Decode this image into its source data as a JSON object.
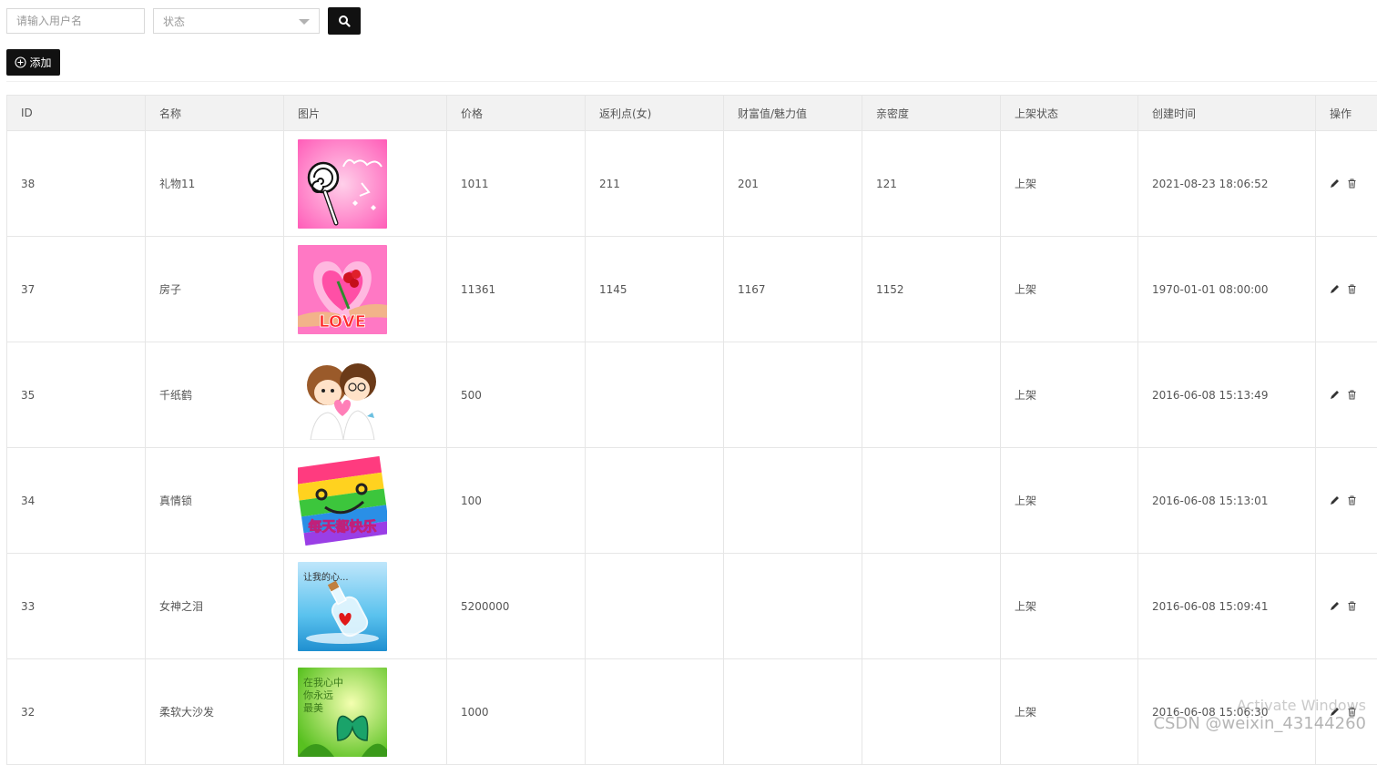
{
  "toolbar": {
    "username_placeholder": "请输入用户名",
    "status_placeholder": "状态",
    "add_label": "添加"
  },
  "table": {
    "headers": [
      "ID",
      "名称",
      "图片",
      "价格",
      "返利点(女)",
      "财富值/魅力值",
      "亲密度",
      "上架状态",
      "创建时间",
      "操作"
    ],
    "rows": [
      {
        "id": "38",
        "name": "礼物11",
        "image": "lollipop-love",
        "price": "1011",
        "rebate": "211",
        "wealth": "201",
        "intimacy": "121",
        "status": "上架",
        "created": "2021-08-23 18:06:52"
      },
      {
        "id": "37",
        "name": "房子",
        "image": "heart-rose-love",
        "price": "11361",
        "rebate": "1145",
        "wealth": "1167",
        "intimacy": "1152",
        "status": "上架",
        "created": "1970-01-01 08:00:00"
      },
      {
        "id": "35",
        "name": "千纸鹤",
        "image": "cartoon-couple",
        "price": "500",
        "rebate": "",
        "wealth": "",
        "intimacy": "",
        "status": "上架",
        "created": "2016-06-08 15:13:49"
      },
      {
        "id": "34",
        "name": "真情锁",
        "image": "rainbow-smile",
        "price": "100",
        "rebate": "",
        "wealth": "",
        "intimacy": "",
        "status": "上架",
        "created": "2016-06-08 15:13:01"
      },
      {
        "id": "33",
        "name": "女神之泪",
        "image": "bottle-heart-sea",
        "price": "5200000",
        "rebate": "",
        "wealth": "",
        "intimacy": "",
        "status": "上架",
        "created": "2016-06-08 15:09:41"
      },
      {
        "id": "32",
        "name": "柔软大沙发",
        "image": "green-butterfly",
        "price": "1000",
        "rebate": "",
        "wealth": "",
        "intimacy": "",
        "status": "上架",
        "created": "2016-06-08 15:06:30"
      }
    ]
  },
  "watermark": {
    "activate": "Activate Windows",
    "csdn": "CSDN @weixin_43144260"
  }
}
